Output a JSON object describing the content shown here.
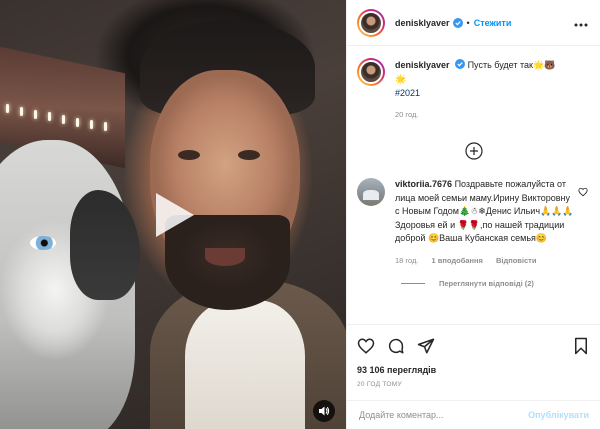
{
  "post": {
    "username": "denisklyaver",
    "separator": "•",
    "follow_label": "Стежити",
    "caption": {
      "username": "denisklyaver",
      "text": "Пусть будет так🌟🐻",
      "line2": "🌟",
      "hashtag": "#2021",
      "time": "20 год."
    },
    "comment": {
      "username": "viktoriia.7676",
      "text": "Поздравьте пожалуйста от лица моей семьи маму.Ирину Викторовну с Новым Годом🎄☃❄Денис Ильич🙏🙏🙏Здоровья ей и 🌹🌹,по нашей традиции доброй 😊Ваша Кубанская семья😊",
      "time": "18 год.",
      "likes": "1 вподобання",
      "reply": "Відповісти",
      "view_replies": "Переглянути відповіді (2)"
    },
    "views": "93 106 переглядів",
    "posted_ago": "20 ГОД ТОМУ",
    "comment_input": {
      "placeholder": "Додайте коментар..."
    },
    "publish_label": "Опублікувати"
  },
  "colors": {
    "link_blue": "#0095f6",
    "publish_disabled": "#b2dffc",
    "muted_text": "#8e8e8e",
    "verified_blue": "#3897f0"
  },
  "icons": {
    "verified": "verified-badge-icon",
    "more": "more-options-icon",
    "play": "play-icon",
    "mute": "speaker-icon",
    "add": "plus-circle-icon",
    "like": "heart-icon",
    "comment": "comment-icon",
    "share": "share-icon",
    "save": "bookmark-icon"
  }
}
